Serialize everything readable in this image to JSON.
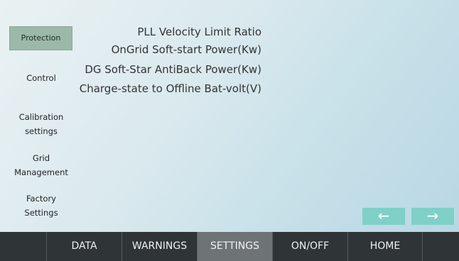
{
  "sidebar": {
    "items": [
      {
        "label": "Protection",
        "active": true
      },
      {
        "label": "Control"
      },
      {
        "label": "Calibration\nsettings"
      },
      {
        "label": "Grid\nManagement"
      },
      {
        "label": "Factory\nSettings"
      }
    ]
  },
  "params": [
    "PLL Velocity Limit Ratio",
    "OnGrid Soft-start Power(Kw)",
    "DG Soft-Star AntiBack Power(Kw)",
    "Charge-state to Offline Bat-volt(V)"
  ],
  "nav": {
    "prev_symbol": "←",
    "next_symbol": "→"
  },
  "tabs": [
    "DATA",
    "WARNINGS",
    "SETTINGS",
    "ON/OFF",
    "HOME"
  ],
  "active_tab": "SETTINGS",
  "colors": {
    "accent": "#7fd0c7",
    "tabbar": "#2f3536",
    "tab_active": "#6e7475",
    "side_active": "#9cb8a8"
  }
}
